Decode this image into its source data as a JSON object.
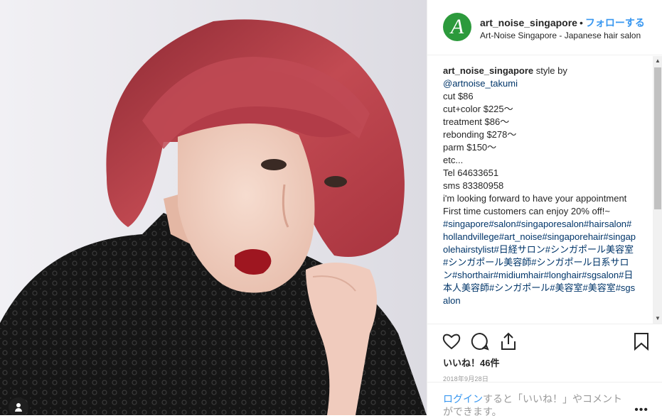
{
  "post": {
    "username": "art_noise_singapore",
    "separator": "•",
    "follow_label": "フォローする",
    "location": "Art-Noise Singapore - Japanese hair salon",
    "avatar_letter": "A",
    "avatar_color": "#2c9a3c"
  },
  "caption": {
    "username": "art_noise_singapore",
    "intro": " style by",
    "mention": "@artnoise_takumi",
    "lines": [
      "cut $86",
      "cut+color $225〜",
      "treatment $86〜",
      "rebonding $278〜",
      "parm $150〜",
      "etc...",
      "Tel 64633651",
      "sms 83380958",
      "i'm looking forward to have your appointment",
      "First time customers can enjoy 20% off!~"
    ],
    "hashtags": "#singapore#salon#singaporesalon#hairsalon#hollandvillege#art_noise#singaporehair#singapolehairstylist#日経サロン#シンガポール美容室#シンガポール美容師#シンガポール日系サロン#shorthair#midiumhair#longhair#sgsalon#日本人美容師#シンガポール#美容室#美容室#sgsalon"
  },
  "actions": {
    "like_icon": "heart-icon",
    "comment_icon": "comment-icon",
    "share_icon": "share-icon",
    "save_icon": "bookmark-icon",
    "likes_text": "いいね！46件",
    "date": "2018年9月28日"
  },
  "login": {
    "link": "ログイン",
    "text": "すると「いいね！」やコメントができます。",
    "more": "•••"
  },
  "colors": {
    "link": "#3897f0",
    "hashtag": "#003569",
    "hair": "#b8424c",
    "lips": "#9e1620"
  }
}
